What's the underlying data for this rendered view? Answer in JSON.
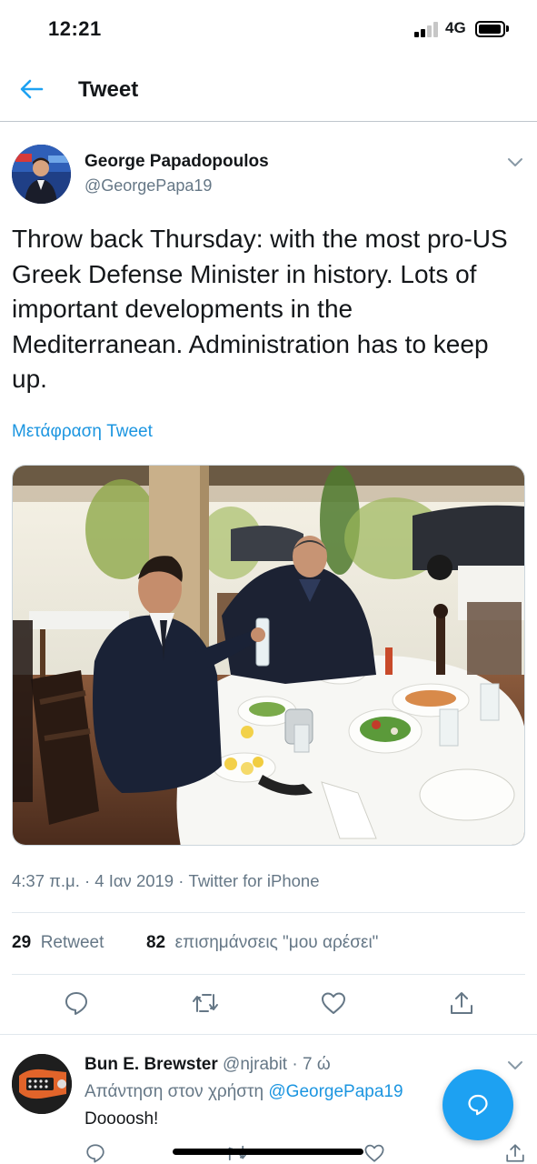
{
  "status_bar": {
    "time": "12:21",
    "network": "4G"
  },
  "header": {
    "title": "Tweet"
  },
  "tweet": {
    "author_name": "George Papadopoulos",
    "author_handle": "@GeorgePapa19",
    "text": "Throw back Thursday: with the most pro-US Greek Defense Minister in history. Lots of important developments in the Mediterranean. Administration has to keep up.",
    "translate_label": "Μετάφραση Tweet",
    "timestamp": "4:37 π.μ. · 4 Ιαν 2019 · Twitter for iPhone",
    "retweet_count": "29",
    "retweet_label": "Retweet",
    "like_count": "82",
    "like_label": "επισημάνσεις \"μου αρέσει\""
  },
  "reply": {
    "author_name": "Bun E. Brewster",
    "author_handle": "@njrabit",
    "time_ago": "· 7 ώ",
    "replying_to_prefix": "Απάντηση στον χρήστη",
    "replying_to_handle": "@GeorgePapa19",
    "text": "Doooosh!"
  },
  "colors": {
    "accent": "#1da1f2",
    "link": "#1b95e0",
    "secondary_text": "#657786"
  },
  "icons": [
    "back-arrow-icon",
    "chevron-down-icon",
    "reply-icon",
    "retweet-icon",
    "like-icon",
    "share-icon",
    "compose-reply-icon"
  ]
}
